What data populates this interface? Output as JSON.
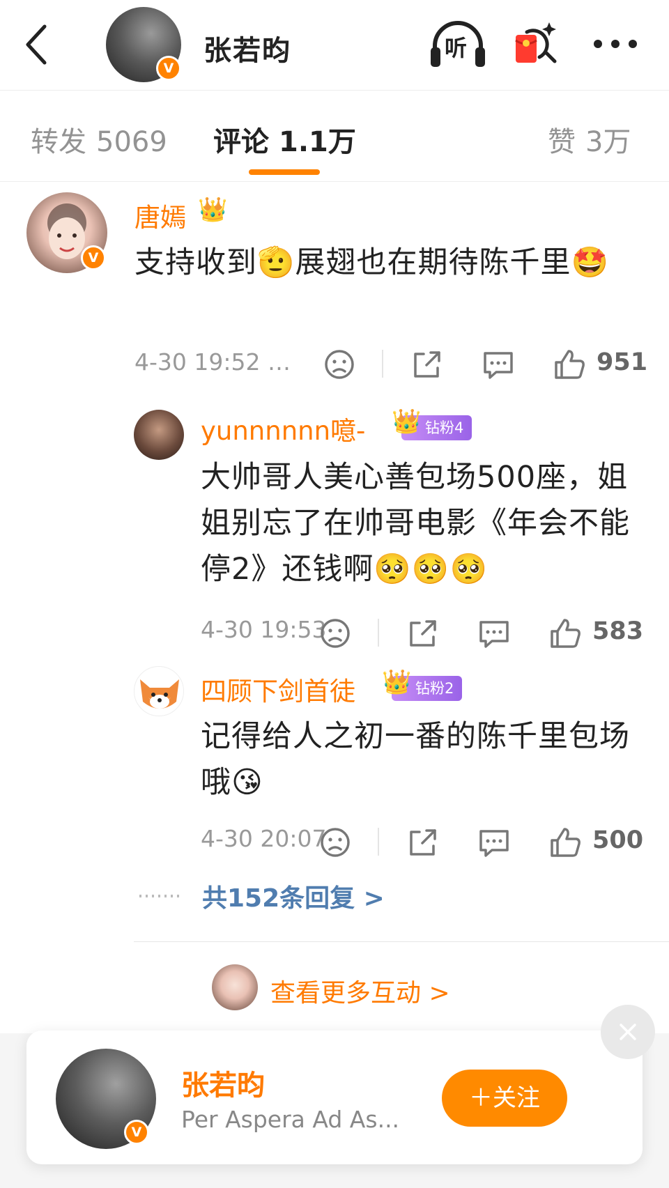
{
  "header": {
    "title": "张若昀",
    "verified_badge": "V",
    "listen_label": "听"
  },
  "tabs": [
    {
      "label": "转发",
      "count": "5069"
    },
    {
      "label": "评论",
      "count": "1.1万"
    },
    {
      "label": "赞",
      "count": "3万"
    }
  ],
  "comments": [
    {
      "user": "唐嫣",
      "verified_badge": "V",
      "text": "支持收到🫡展翅也在期待陈千里🤩",
      "time": "4-30 19:52 …",
      "likes": "951"
    },
    {
      "user": "yunnnnnn噫-",
      "fan_badge": "钻粉4",
      "text": "大帅哥人美心善包场500座，姐姐别忘了在帅哥电影《年会不能停2》还钱啊🥺🥺🥺",
      "time": "4-30 19:53",
      "likes": "583"
    },
    {
      "user": "四顾下剑首徒",
      "fan_badge": "钻粉2",
      "text": "记得给人之初一番的陈千里包场哦😘",
      "time": "4-30 20:07",
      "likes": "500"
    }
  ],
  "replies_link": "共152条回复 >",
  "more_interactions": "查看更多互动 >",
  "follow_card": {
    "name": "张若昀",
    "desc": "Per Aspera Ad As...",
    "follow_label": "＋关注",
    "verified_badge": "V"
  },
  "colors": {
    "accent": "#ff8200",
    "username": "#ff7a00",
    "link": "#507daf",
    "fan_badge": "#9a63e8"
  },
  "icons": [
    "back-icon",
    "headphones-icon",
    "red-packet-icon",
    "more-icon",
    "sad-face-icon",
    "share-icon",
    "comment-icon",
    "thumbs-up-icon",
    "close-icon"
  ]
}
